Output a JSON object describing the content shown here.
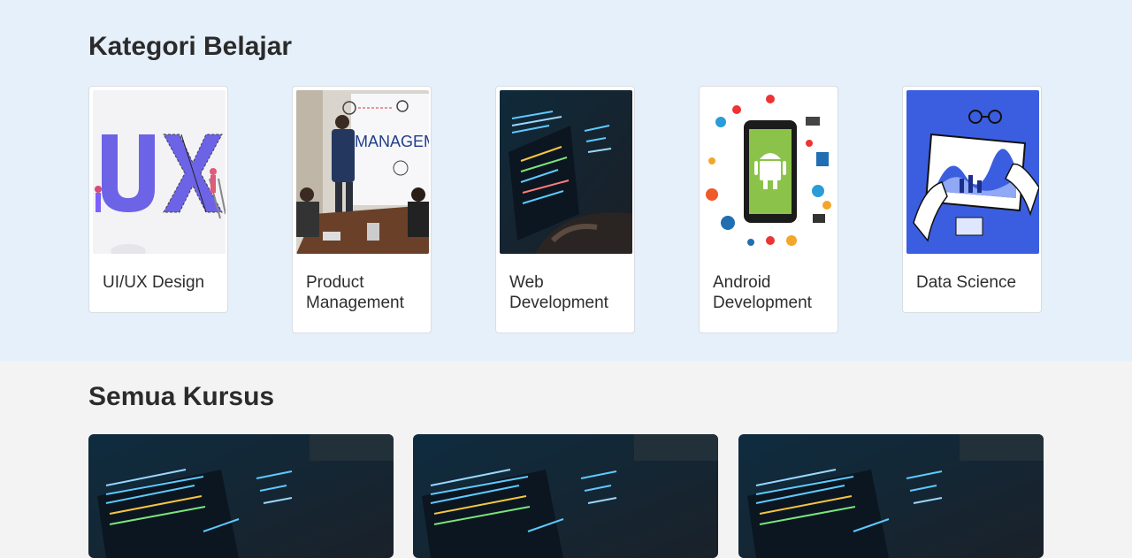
{
  "categories_section": {
    "title": "Kategori Belajar",
    "items": [
      {
        "label": "UI/UX Design",
        "image": "ui-ux-illustration"
      },
      {
        "label": "Product Management",
        "image": "product-meeting-photo"
      },
      {
        "label": "Web Development",
        "image": "code-screen-photo"
      },
      {
        "label": "Android Development",
        "image": "android-phone-illustration"
      },
      {
        "label": "Data Science",
        "image": "data-charts-illustration"
      }
    ]
  },
  "courses_section": {
    "title": "Semua Kursus",
    "courses": [
      {
        "image": "code-screen-photo"
      },
      {
        "image": "code-screen-photo"
      },
      {
        "image": "code-screen-photo"
      }
    ]
  },
  "colors": {
    "category_bg": "#e6f0fa",
    "page_bg": "#f3f3f3",
    "heading": "#2b2b2b",
    "ux_purple": "#6c63e6",
    "android_green": "#8bc34a",
    "data_blue": "#3b5ee0"
  }
}
